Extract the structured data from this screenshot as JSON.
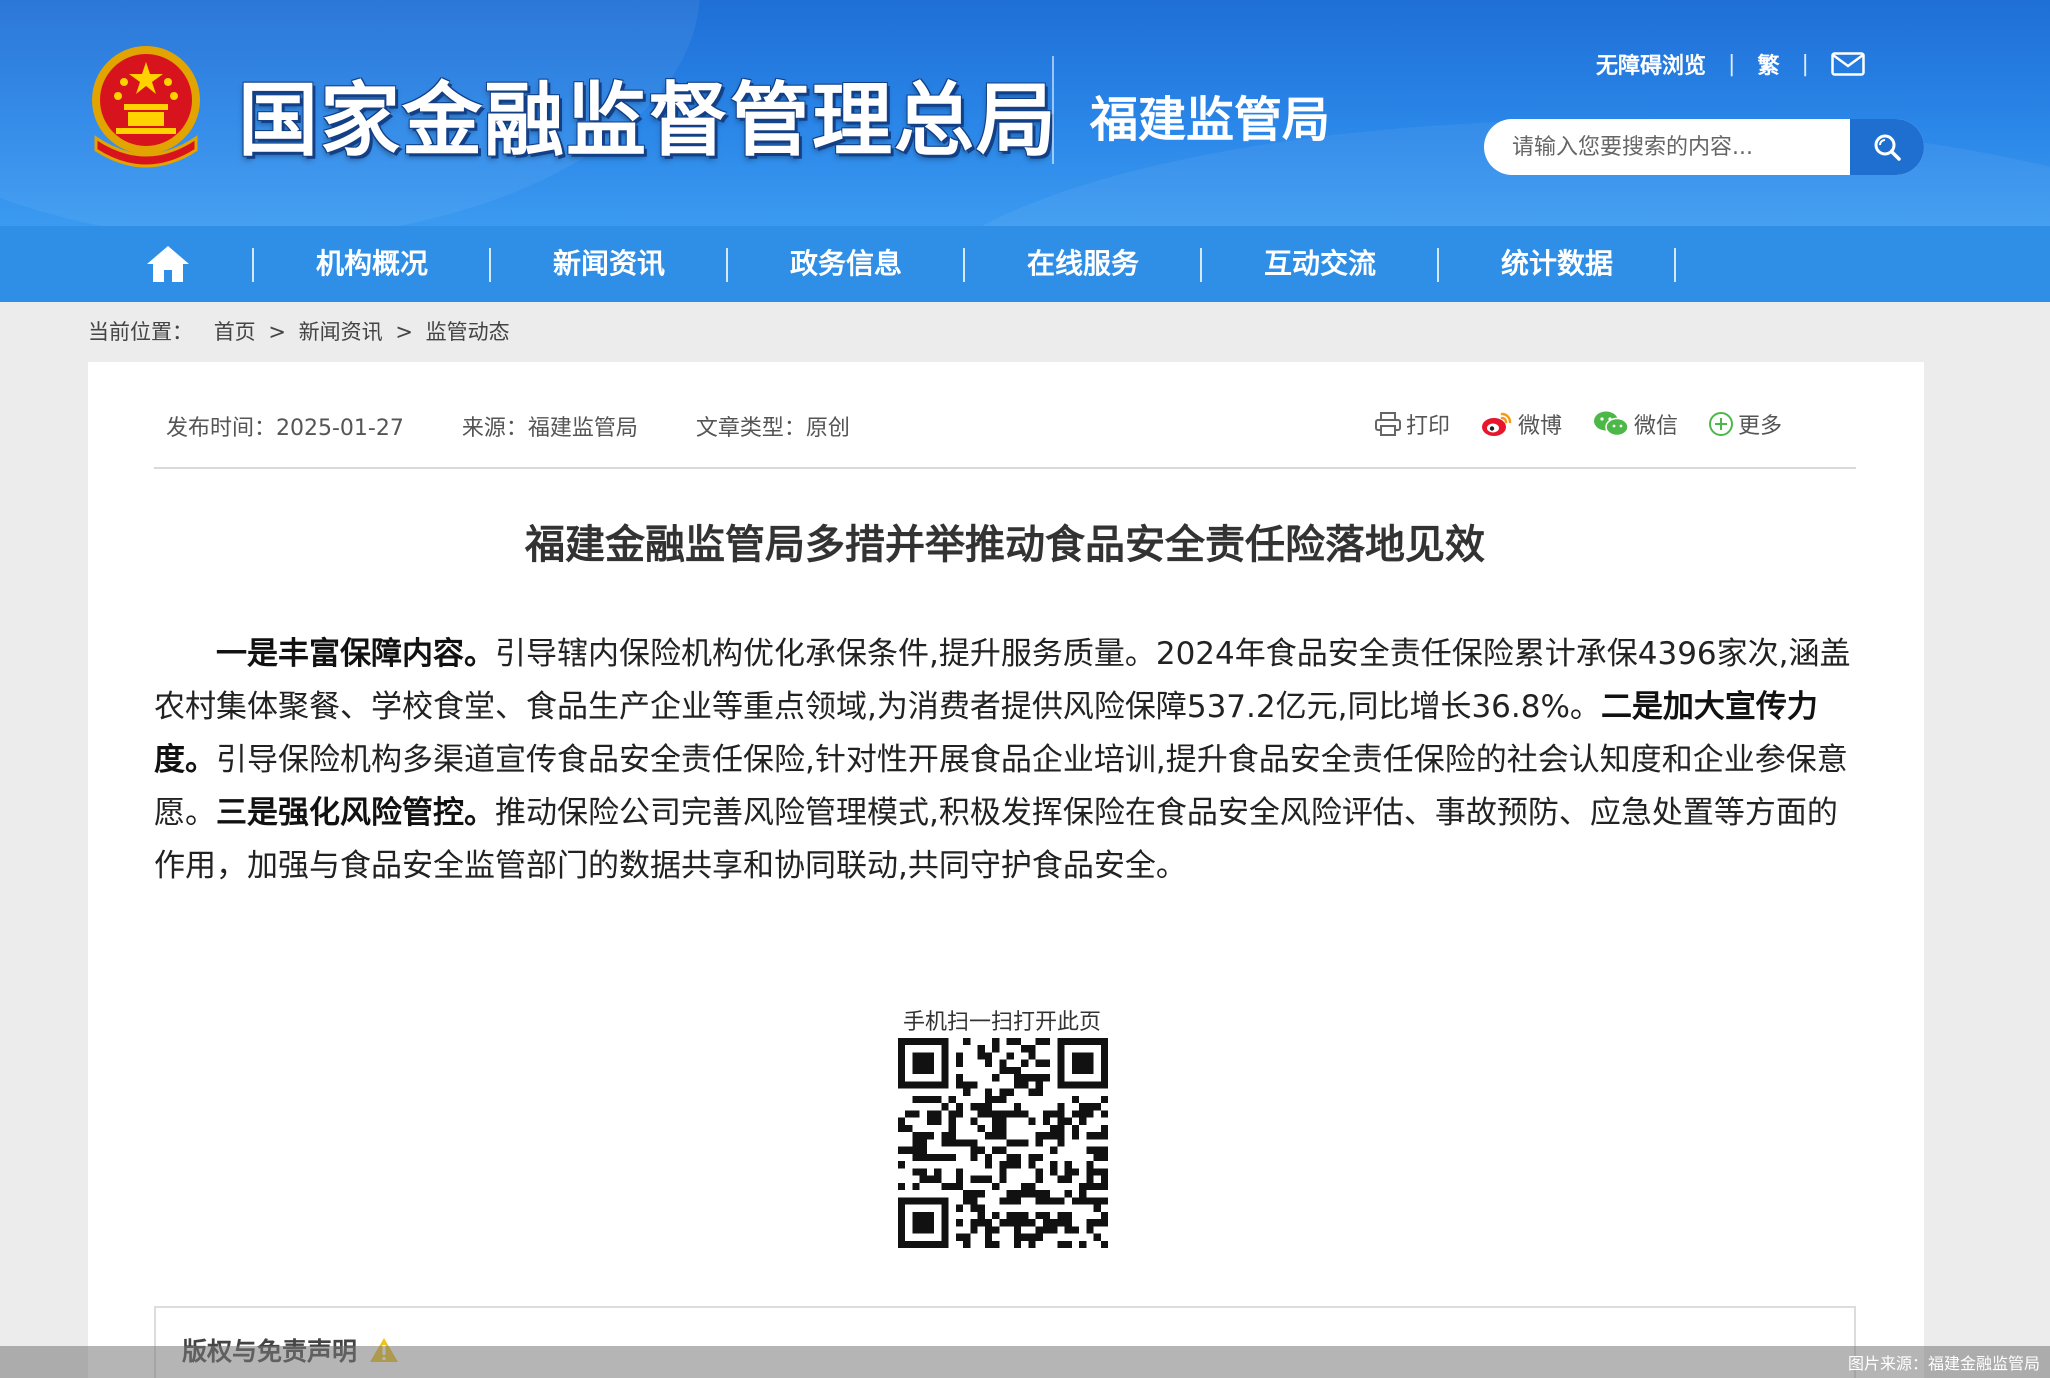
{
  "header": {
    "site_title": "国家金融监督管理总局",
    "sub_title": "福建监管局",
    "accessibility_link": "无障碍浏览",
    "traditional_link": "繁",
    "separator": "|",
    "search_placeholder": "请输入您要搜索的内容...",
    "icons": {
      "emblem": "national-emblem-icon",
      "mail": "mail-icon",
      "search": "search-icon"
    }
  },
  "nav": {
    "home_icon": "home-icon",
    "items": [
      "机构概况",
      "新闻资讯",
      "政务信息",
      "在线服务",
      "互动交流",
      "统计数据"
    ]
  },
  "breadcrumb": {
    "label": "当前位置：",
    "items": [
      "首页",
      "新闻资讯",
      "监管动态"
    ],
    "separator": ">"
  },
  "article_meta": {
    "publish_time": "发布时间：2025-01-27",
    "source": "来源：福建监管局",
    "type": "文章类型：原创"
  },
  "share": {
    "print": "打印",
    "weibo": "微博",
    "wechat": "微信",
    "more": "更多"
  },
  "article": {
    "title": "福建金融监管局多措并举推动食品安全责任险落地见效",
    "p1_bold": "一是丰富保障内容。",
    "p1_text": "引导辖内保险机构优化承保条件,提升服务质量。2024年食品安全责任保险累计承保4396家次,涵盖农村集体聚餐、学校食堂、食品生产企业等重点领域,为消费者提供风险保障537.2亿元,同比增长36.8%。",
    "p2_bold": "二是加大宣传力度。",
    "p2_text": "引导保险机构多渠道宣传食品安全责任保险,针对性开展食品企业培训,提升食品安全责任保险的社会认知度和企业参保意愿。",
    "p3_bold": "三是强化风险管控。",
    "p3_text": "推动保险公司完善风险管理模式,积极发挥保险在食品安全风险评估、事故预防、应急处置等方面的作用，加强与食品安全监管部门的数据共享和协同联动,共同守护食品安全。"
  },
  "qr": {
    "label": "手机扫一扫打开此页"
  },
  "copyright": {
    "title": "版权与免责声明"
  },
  "image_credit": "图片来源：福建金融监管局",
  "colors": {
    "header_blue": "#2a86e8",
    "nav_blue": "#2f8ee6",
    "search_btn": "#1e6fd0"
  }
}
